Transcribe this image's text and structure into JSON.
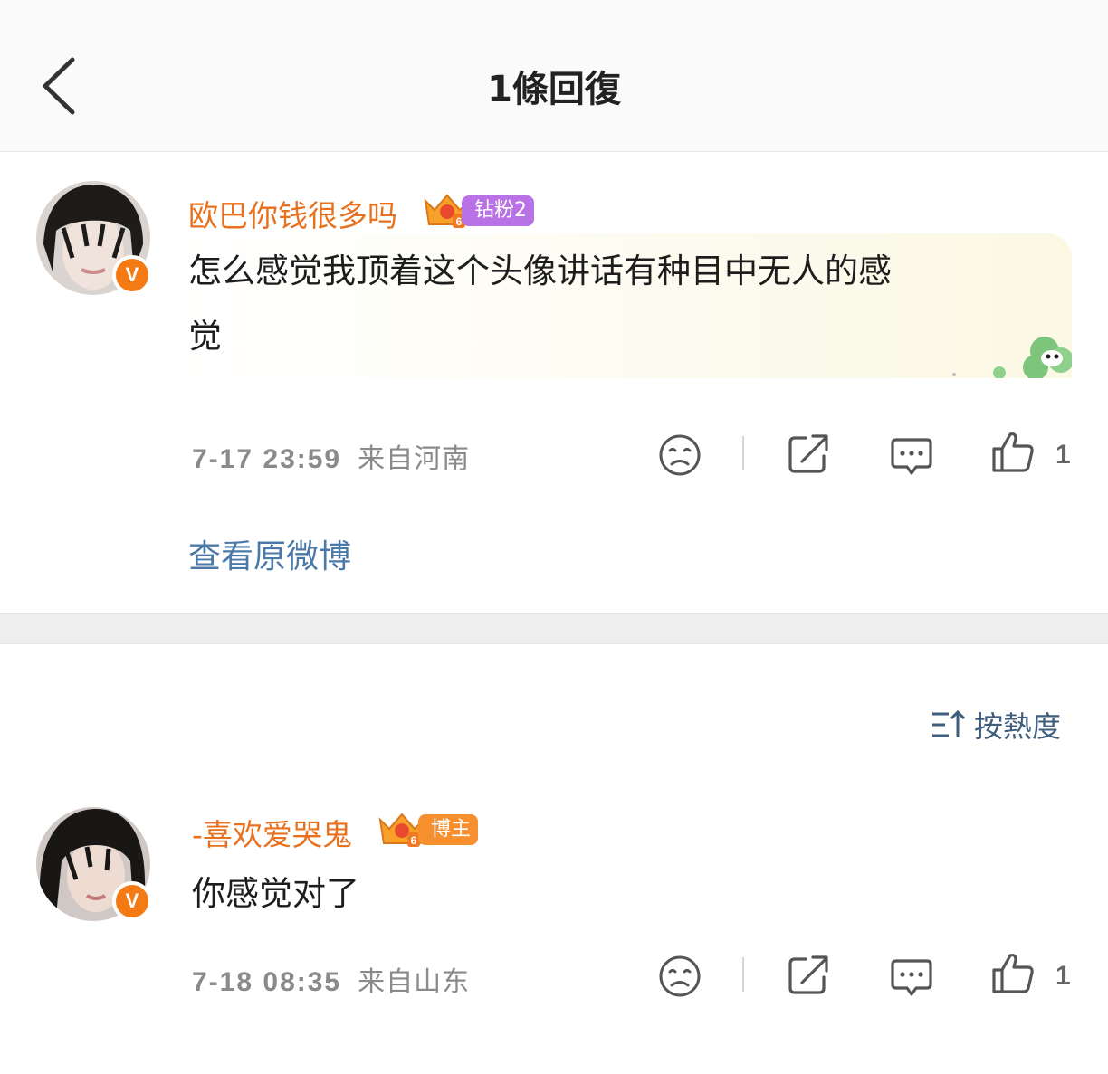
{
  "header": {
    "title": "1條回復"
  },
  "post": {
    "username": "欧巴你钱很多吗",
    "fan_level": "6",
    "fan_badge": "钻粉2",
    "text_line1": "怎么感觉我顶着这个头像讲话有种目中无人的感",
    "text_line2": "觉",
    "time": "7-17 23:59",
    "location": "来自河南",
    "likes": "1",
    "view_original": "查看原微博",
    "verified_mark": "V"
  },
  "sort": {
    "label": "按熱度"
  },
  "reply": {
    "username": "-喜欢爱哭鬼",
    "fan_level": "6",
    "fan_badge": "博主",
    "text": "你感觉对了",
    "time": "7-18 08:35",
    "location": "来自山东",
    "likes": "1",
    "verified_mark": "V"
  },
  "colors": {
    "username": "#e8711f",
    "link": "#4b79a8",
    "verified": "#f47a14",
    "fan_badge_purple": "#b872e6",
    "fan_badge_orange": "#f6902e"
  },
  "icons": [
    "back-chevron-icon",
    "dislike-face-icon",
    "share-icon",
    "comment-icon",
    "thumbs-up-icon",
    "sort-icon",
    "crown-icon",
    "verified-icon"
  ]
}
